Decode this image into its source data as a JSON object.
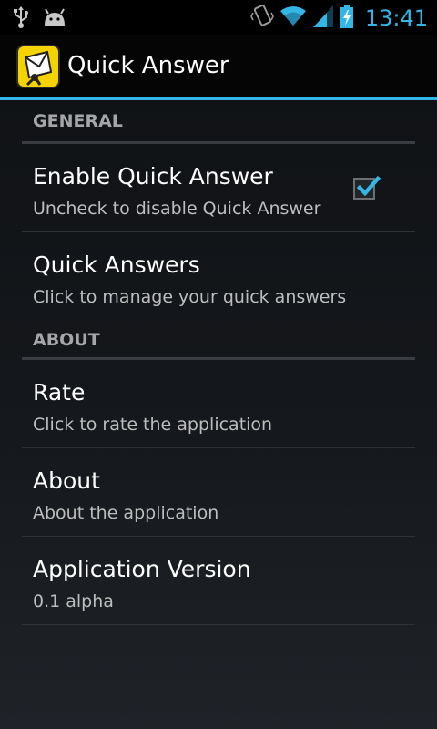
{
  "status_bar": {
    "time": "13:41",
    "icons": [
      "usb-icon",
      "android-debug-icon",
      "vibrate-icon",
      "wifi-icon",
      "signal-icon",
      "battery-charging-icon"
    ]
  },
  "action_bar": {
    "title": "Quick Answer",
    "icon": "app-logo-icon"
  },
  "sections": [
    {
      "header": "GENERAL",
      "items": [
        {
          "title": "Enable Quick Answer",
          "summary": "Uncheck to disable Quick Answer",
          "checked": true
        },
        {
          "title": "Quick Answers",
          "summary": "Click to manage your quick answers"
        }
      ]
    },
    {
      "header": "ABOUT",
      "items": [
        {
          "title": "Rate",
          "summary": "Click to rate the application"
        },
        {
          "title": "About",
          "summary": "About the application"
        },
        {
          "title": "Application Version",
          "summary": "0.1 alpha"
        }
      ]
    }
  ],
  "colors": {
    "accent": "#33b5e5",
    "background": "#15181c",
    "divider": "#3a3d42"
  }
}
